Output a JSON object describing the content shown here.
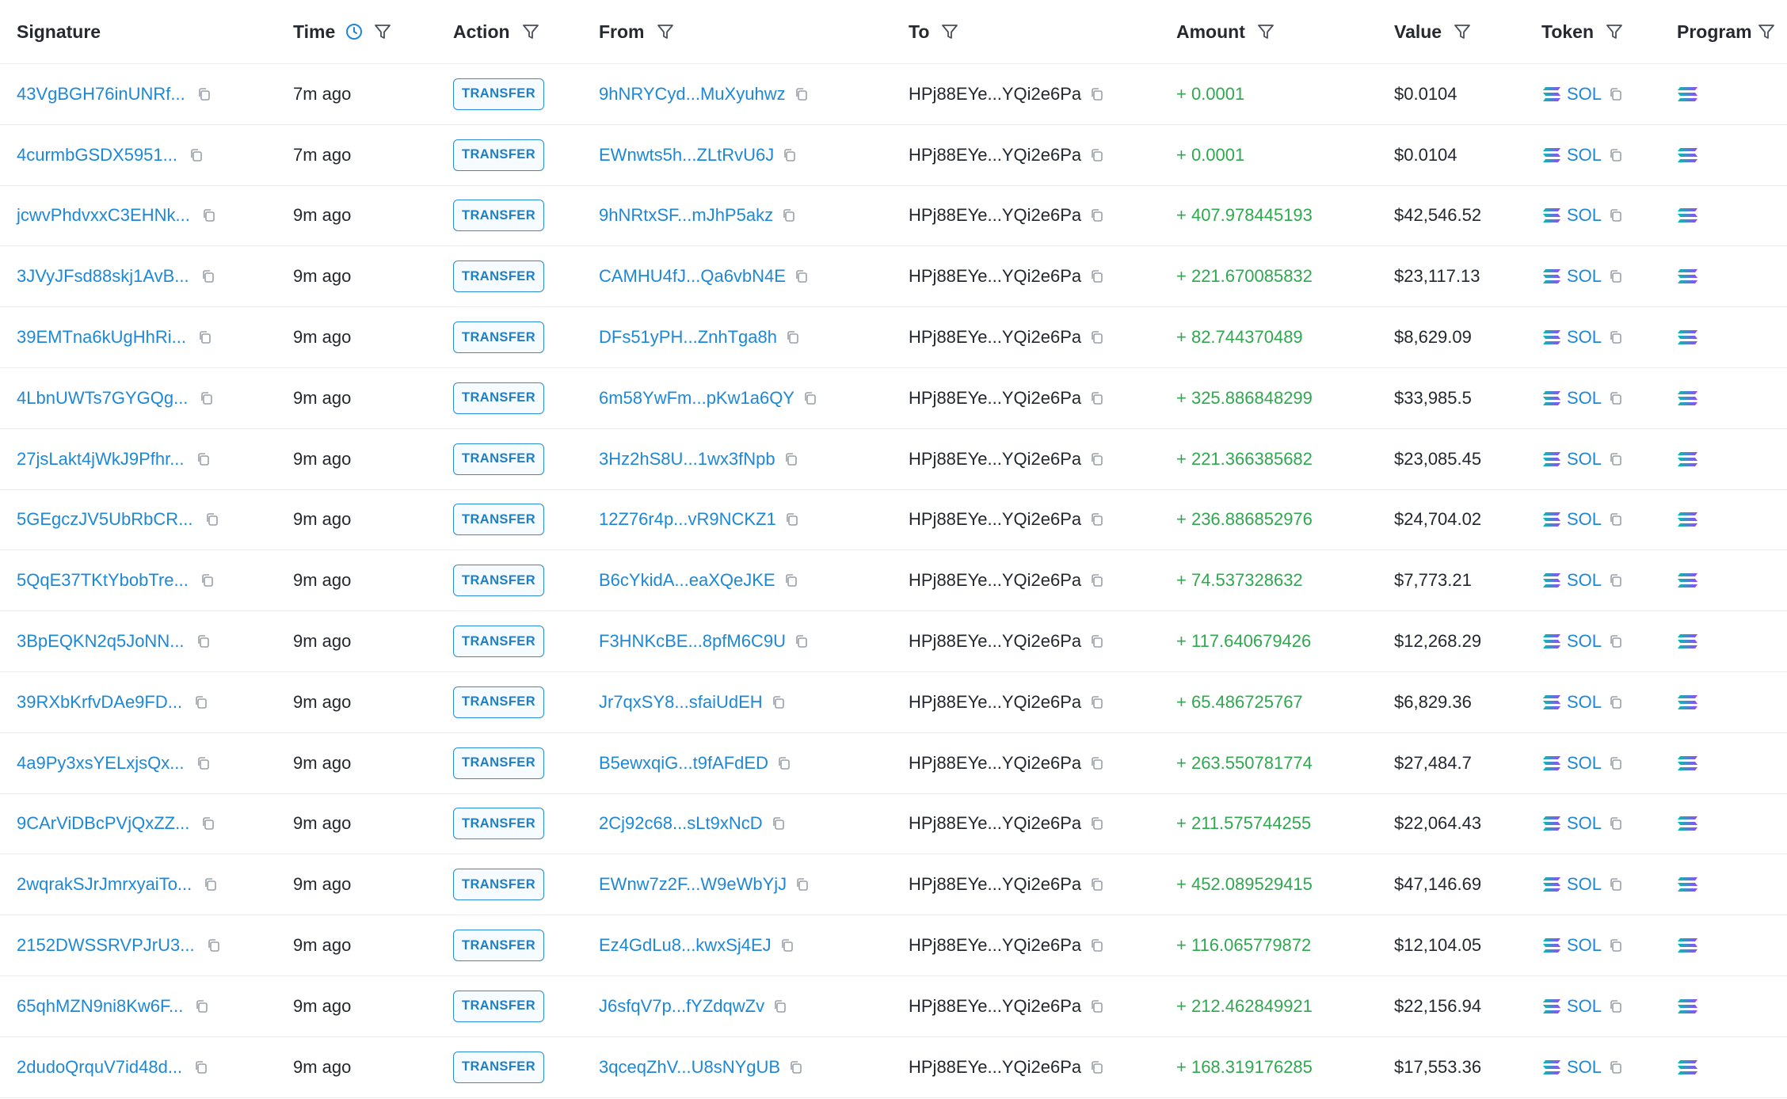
{
  "columns": {
    "signature": "Signature",
    "time": "Time",
    "action": "Action",
    "from": "From",
    "to": "To",
    "amount": "Amount",
    "value": "Value",
    "token": "Token",
    "program": "Program"
  },
  "icons": {
    "filter": "filter-icon",
    "clock": "clock-icon",
    "copy": "copy-icon",
    "token_logo": "solana-logo-icon"
  },
  "colors": {
    "link": "#1e88d6",
    "amount_positive": "#2fa84f",
    "badge_border": "#2b8fd3",
    "clock_accent": "#1e88d6"
  },
  "rows": [
    {
      "signature": "43VgBGH76inUNRf...",
      "time": "7m ago",
      "action": "TRANSFER",
      "from": "9hNRYCyd...MuXyuhwz",
      "to": "HPj88EYe...YQi2e6Pa",
      "amount": "+ 0.0001",
      "value": "$0.0104",
      "token": "SOL"
    },
    {
      "signature": "4curmbGSDX5951...",
      "time": "7m ago",
      "action": "TRANSFER",
      "from": "EWnwts5h...ZLtRvU6J",
      "to": "HPj88EYe...YQi2e6Pa",
      "amount": "+ 0.0001",
      "value": "$0.0104",
      "token": "SOL"
    },
    {
      "signature": "jcwvPhdvxxC3EHNk...",
      "time": "9m ago",
      "action": "TRANSFER",
      "from": "9hNRtxSF...mJhP5akz",
      "to": "HPj88EYe...YQi2e6Pa",
      "amount": "+ 407.978445193",
      "value": "$42,546.52",
      "token": "SOL"
    },
    {
      "signature": "3JVyJFsd88skj1AvB...",
      "time": "9m ago",
      "action": "TRANSFER",
      "from": "CAMHU4fJ...Qa6vbN4E",
      "to": "HPj88EYe...YQi2e6Pa",
      "amount": "+ 221.670085832",
      "value": "$23,117.13",
      "token": "SOL"
    },
    {
      "signature": "39EMTna6kUgHhRi...",
      "time": "9m ago",
      "action": "TRANSFER",
      "from": "DFs51yPH...ZnhTga8h",
      "to": "HPj88EYe...YQi2e6Pa",
      "amount": "+ 82.744370489",
      "value": "$8,629.09",
      "token": "SOL"
    },
    {
      "signature": "4LbnUWTs7GYGQg...",
      "time": "9m ago",
      "action": "TRANSFER",
      "from": "6m58YwFm...pKw1a6QY",
      "to": "HPj88EYe...YQi2e6Pa",
      "amount": "+ 325.886848299",
      "value": "$33,985.5",
      "token": "SOL"
    },
    {
      "signature": "27jsLakt4jWkJ9Pfhr...",
      "time": "9m ago",
      "action": "TRANSFER",
      "from": "3Hz2hS8U...1wx3fNpb",
      "to": "HPj88EYe...YQi2e6Pa",
      "amount": "+ 221.366385682",
      "value": "$23,085.45",
      "token": "SOL"
    },
    {
      "signature": "5GEgczJV5UbRbCR...",
      "time": "9m ago",
      "action": "TRANSFER",
      "from": "12Z76r4p...vR9NCKZ1",
      "to": "HPj88EYe...YQi2e6Pa",
      "amount": "+ 236.886852976",
      "value": "$24,704.02",
      "token": "SOL"
    },
    {
      "signature": "5QqE37TKtYbobTre...",
      "time": "9m ago",
      "action": "TRANSFER",
      "from": "B6cYkidA...eaXQeJKE",
      "to": "HPj88EYe...YQi2e6Pa",
      "amount": "+ 74.537328632",
      "value": "$7,773.21",
      "token": "SOL"
    },
    {
      "signature": "3BpEQKN2q5JoNN...",
      "time": "9m ago",
      "action": "TRANSFER",
      "from": "F3HNKcBE...8pfM6C9U",
      "to": "HPj88EYe...YQi2e6Pa",
      "amount": "+ 117.640679426",
      "value": "$12,268.29",
      "token": "SOL"
    },
    {
      "signature": "39RXbKrfvDAe9FD...",
      "time": "9m ago",
      "action": "TRANSFER",
      "from": "Jr7qxSY8...sfaiUdEH",
      "to": "HPj88EYe...YQi2e6Pa",
      "amount": "+ 65.486725767",
      "value": "$6,829.36",
      "token": "SOL"
    },
    {
      "signature": "4a9Py3xsYELxjsQx...",
      "time": "9m ago",
      "action": "TRANSFER",
      "from": "B5ewxqiG...t9fAFdED",
      "to": "HPj88EYe...YQi2e6Pa",
      "amount": "+ 263.550781774",
      "value": "$27,484.7",
      "token": "SOL"
    },
    {
      "signature": "9CArViDBcPVjQxZZ...",
      "time": "9m ago",
      "action": "TRANSFER",
      "from": "2Cj92c68...sLt9xNcD",
      "to": "HPj88EYe...YQi2e6Pa",
      "amount": "+ 211.575744255",
      "value": "$22,064.43",
      "token": "SOL"
    },
    {
      "signature": "2wqrakSJrJmrxyaiTo...",
      "time": "9m ago",
      "action": "TRANSFER",
      "from": "EWnw7z2F...W9eWbYjJ",
      "to": "HPj88EYe...YQi2e6Pa",
      "amount": "+ 452.089529415",
      "value": "$47,146.69",
      "token": "SOL"
    },
    {
      "signature": "2152DWSSRVPJrU3...",
      "time": "9m ago",
      "action": "TRANSFER",
      "from": "Ez4GdLu8...kwxSj4EJ",
      "to": "HPj88EYe...YQi2e6Pa",
      "amount": "+ 116.065779872",
      "value": "$12,104.05",
      "token": "SOL"
    },
    {
      "signature": "65qhMZN9ni8Kw6F...",
      "time": "9m ago",
      "action": "TRANSFER",
      "from": "J6sfqV7p...fYZdqwZv",
      "to": "HPj88EYe...YQi2e6Pa",
      "amount": "+ 212.462849921",
      "value": "$22,156.94",
      "token": "SOL"
    },
    {
      "signature": "2dudoQrquV7id48d...",
      "time": "9m ago",
      "action": "TRANSFER",
      "from": "3qceqZhV...U8sNYgUB",
      "to": "HPj88EYe...YQi2e6Pa",
      "amount": "+ 168.319176285",
      "value": "$17,553.36",
      "token": "SOL"
    }
  ]
}
